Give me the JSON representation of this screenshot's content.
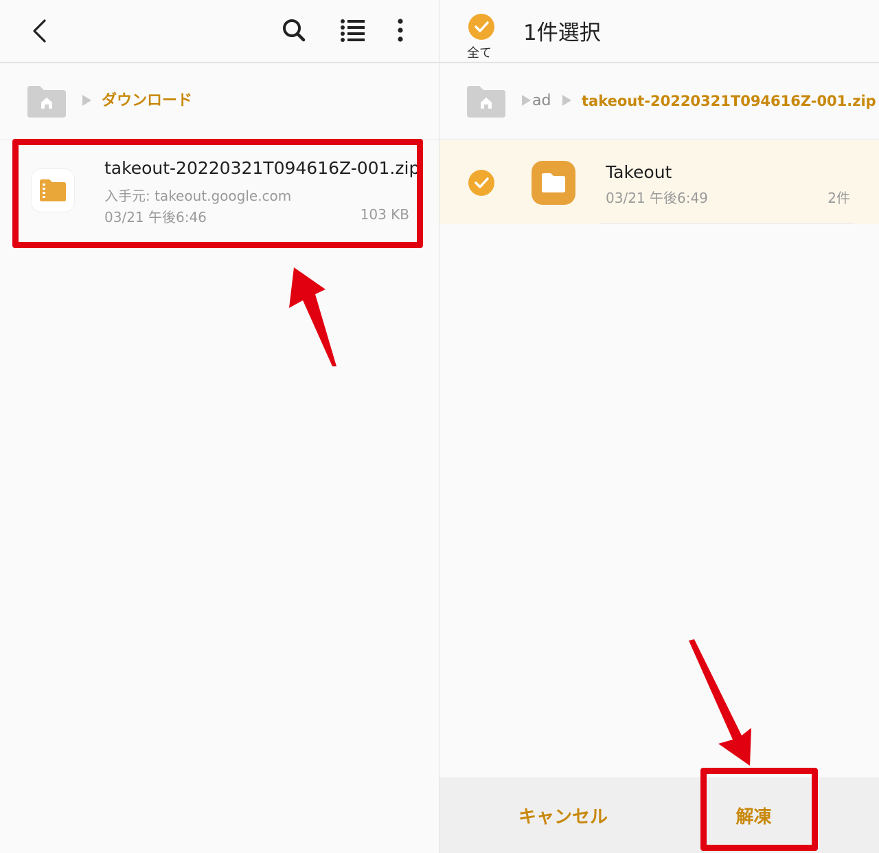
{
  "left_panel": {
    "breadcrumb": {
      "current": "ダウンロード"
    },
    "file": {
      "name": "takeout-20220321T094616Z-001.zip",
      "source": "入手元: takeout.google.com",
      "date": "03/21 午後6:46",
      "size": "103 KB"
    }
  },
  "right_panel": {
    "select_all_label": "全て",
    "selection_count": "1件選択",
    "breadcrumb": {
      "parent": "ad",
      "current": "takeout-20220321T094616Z-001.zip"
    },
    "folder": {
      "name": "Takeout",
      "date": "03/21 午後6:49",
      "count": "2件"
    },
    "actions": {
      "cancel": "キャンセル",
      "extract": "解凍"
    }
  },
  "colors": {
    "accent": "#f0a92e",
    "accent_text": "#c8880b",
    "highlight": "#e10010",
    "selected_row": "#fdf7ea"
  },
  "icons": [
    "back-icon",
    "search-icon",
    "list-view-icon",
    "more-options-icon",
    "home-folder-icon",
    "zip-file-icon",
    "folder-icon",
    "check-icon"
  ]
}
